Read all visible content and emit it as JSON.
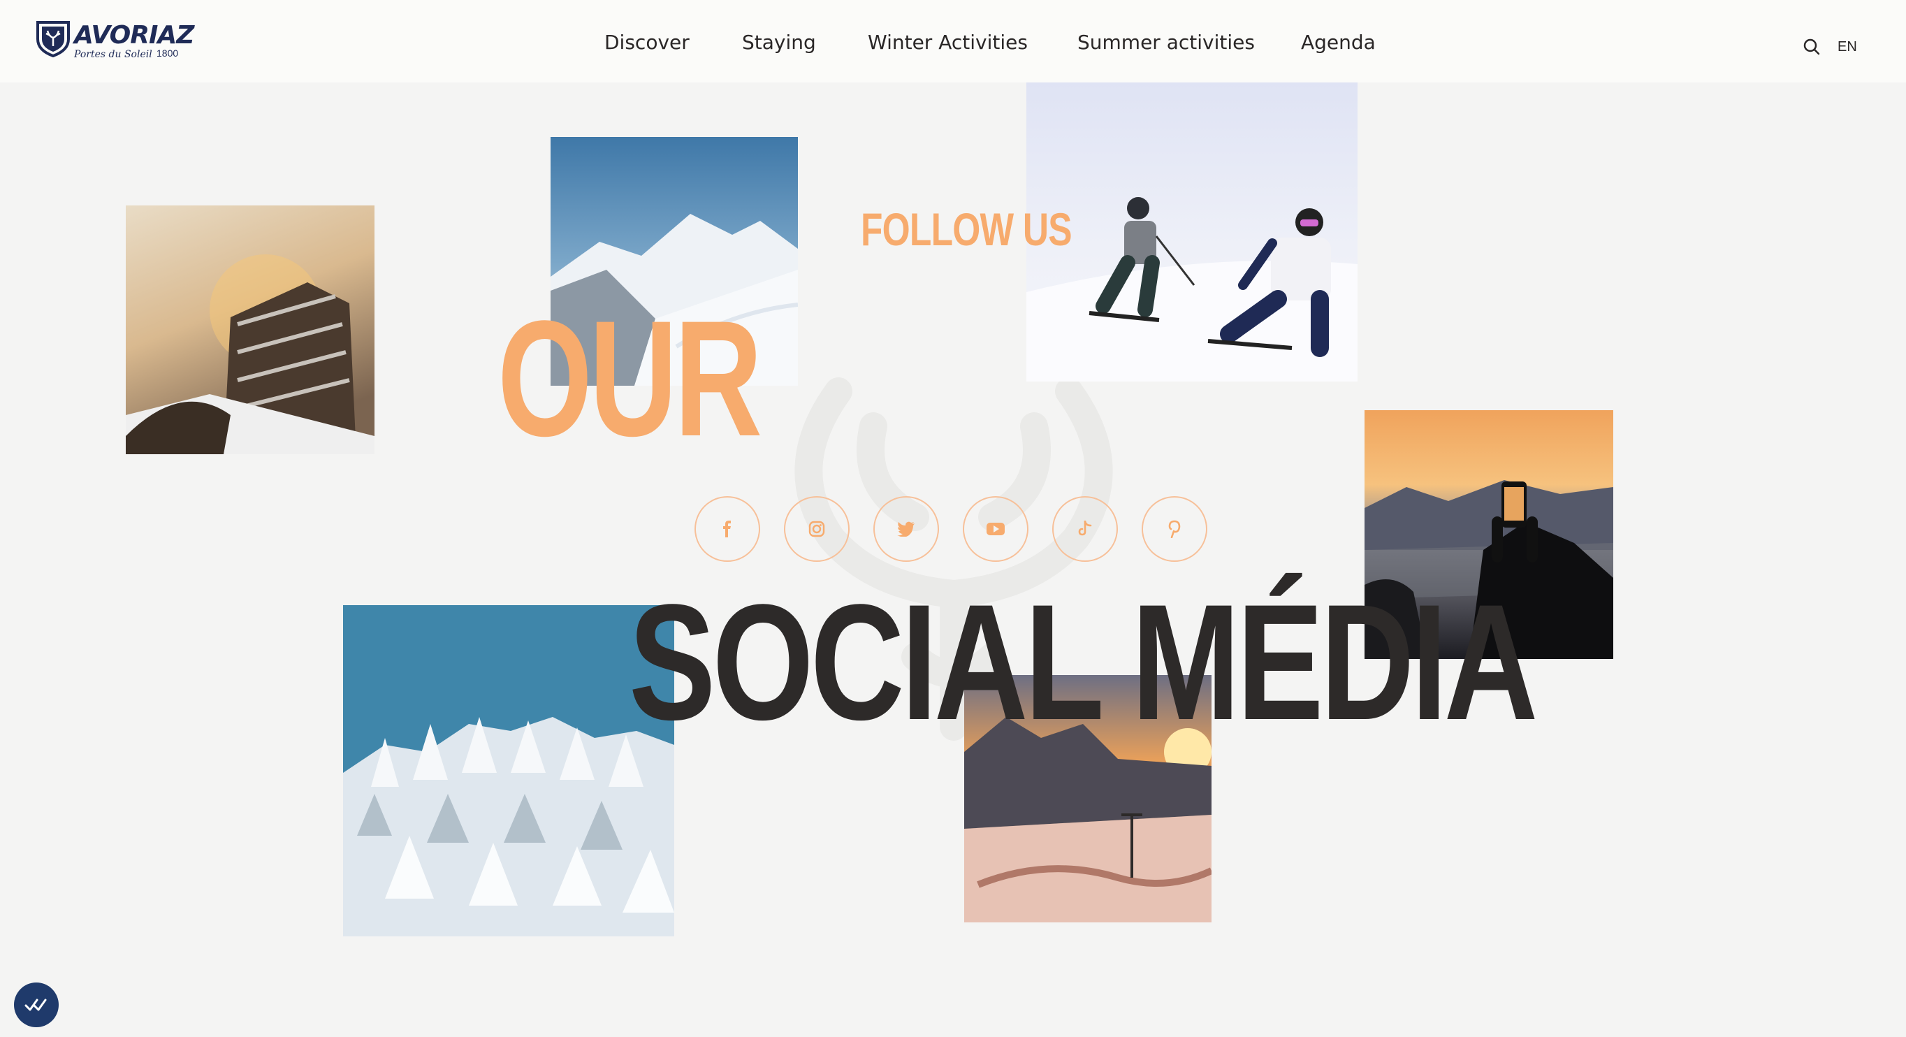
{
  "header": {
    "logo": {
      "name": "AVORIAZ",
      "tagline": "Portes du Soleil",
      "altitude": "1800"
    },
    "nav": [
      {
        "label": "Discover"
      },
      {
        "label": "Staying"
      },
      {
        "label": "Winter Activities"
      },
      {
        "label": "Summer activities"
      },
      {
        "label": "Agenda"
      }
    ],
    "search_icon": "search-icon",
    "language": "EN"
  },
  "section": {
    "kicker": "FOLLOW US",
    "title_line1": "OUR",
    "title_line2": "SOCIAL MÉDIA"
  },
  "socials": [
    {
      "name": "facebook",
      "icon": "facebook-icon"
    },
    {
      "name": "instagram",
      "icon": "instagram-icon"
    },
    {
      "name": "twitter",
      "icon": "twitter-icon"
    },
    {
      "name": "youtube",
      "icon": "youtube-icon"
    },
    {
      "name": "tiktok",
      "icon": "tiktok-icon"
    },
    {
      "name": "pinterest",
      "icon": "pinterest-icon"
    }
  ],
  "photos": [
    {
      "subject": "resort-building-sunset"
    },
    {
      "subject": "snowy-mountain-peaks"
    },
    {
      "subject": "skiers-on-slope"
    },
    {
      "subject": "phone-photo-sunset"
    },
    {
      "subject": "snow-covered-forest"
    },
    {
      "subject": "sunset-snowpark"
    }
  ],
  "colors": {
    "accent": "#f7ab6d",
    "dark_text": "#2d2a29",
    "brand_navy": "#1f2b57",
    "background": "#f4f4f3"
  }
}
